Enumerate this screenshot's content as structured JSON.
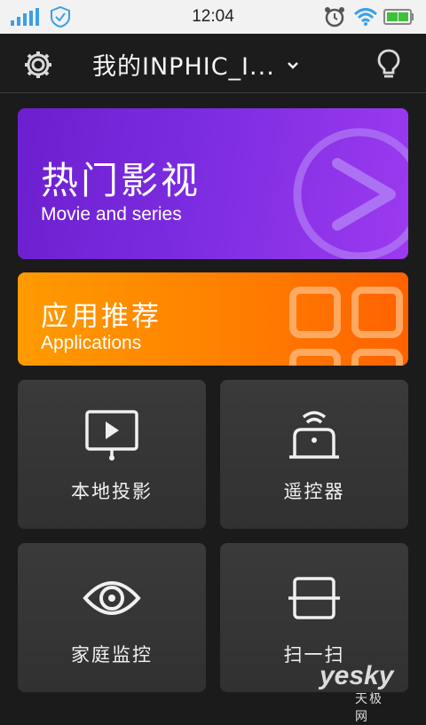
{
  "status": {
    "time": "12:04"
  },
  "header": {
    "device_title": "我的INPHIC_I..."
  },
  "banners": [
    {
      "title_zh": "热门影视",
      "title_en": "Movie and series"
    },
    {
      "title_zh": "应用推荐",
      "title_en": "Applications"
    }
  ],
  "tiles": [
    {
      "label": "本地投影",
      "icon": "screen-play-icon"
    },
    {
      "label": "遥控器",
      "icon": "remote-icon"
    },
    {
      "label": "家庭监控",
      "icon": "eye-icon"
    },
    {
      "label": "扫一扫",
      "icon": "scan-icon"
    }
  ],
  "watermark": {
    "brand": "yesky",
    "sub": "天极网"
  },
  "colors": {
    "banner_movies": "#7c2ce0",
    "banner_apps": "#ff8000",
    "tile_bg": "#363637",
    "background": "#1b1b1c"
  }
}
